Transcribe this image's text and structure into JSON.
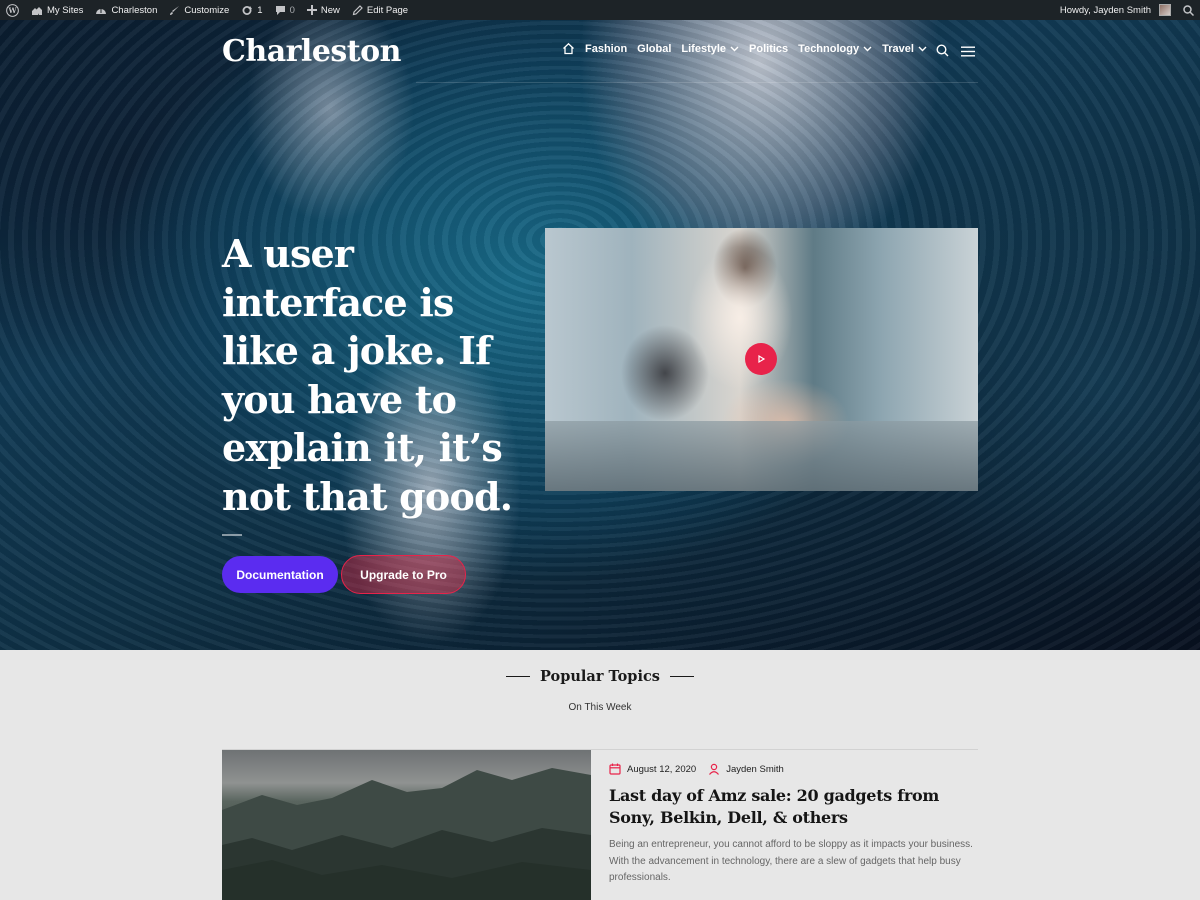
{
  "admin_bar": {
    "my_sites": "My Sites",
    "site_name": "Charleston",
    "customize": "Customize",
    "updates_count": "1",
    "comments_count": "0",
    "new": "New",
    "edit_page": "Edit Page",
    "howdy": "Howdy, Jayden Smith"
  },
  "header": {
    "brand": "Charleston",
    "nav": [
      {
        "label": "Fashion",
        "has_dropdown": false
      },
      {
        "label": "Global",
        "has_dropdown": false
      },
      {
        "label": "Lifestyle",
        "has_dropdown": true
      },
      {
        "label": "Politics",
        "has_dropdown": false
      },
      {
        "label": "Technology",
        "has_dropdown": true
      },
      {
        "label": "Travel",
        "has_dropdown": true
      }
    ]
  },
  "hero": {
    "title": "A user interface is like a joke. If you have to explain it, it’s not that good.",
    "primary_button": "Documentation",
    "secondary_button": "Upgrade to Pro",
    "accent_color": "#5b2cf0",
    "secondary_color": "#e8234a"
  },
  "popular": {
    "title": "Popular Topics",
    "subtitle": "On This Week"
  },
  "post": {
    "date": "August 12, 2020",
    "author": "Jayden Smith",
    "title": "Last day of Amz sale: 20 gadgets from Sony, Belkin, Dell, & others",
    "excerpt": "Being an entrepreneur, you cannot afford to be sloppy as it impacts your business. With the advancement in technology, there are a slew of gadgets that help busy professionals."
  }
}
